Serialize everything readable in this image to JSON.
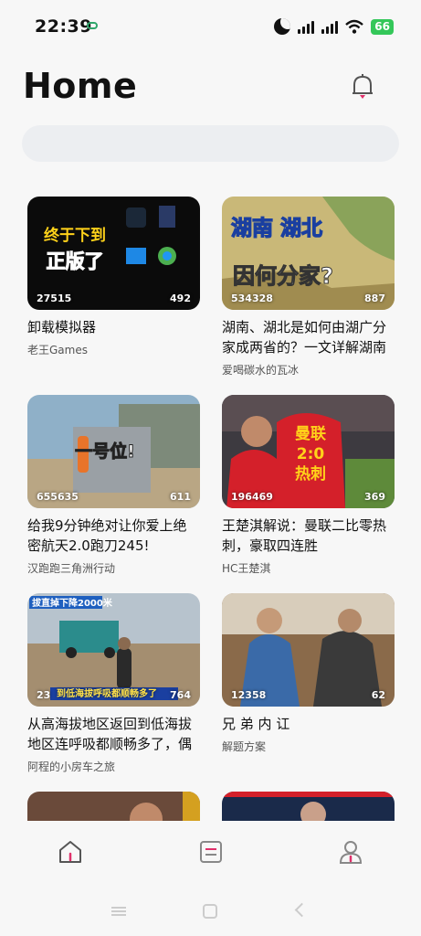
{
  "status_bar": {
    "time": "22:39",
    "battery": "66"
  },
  "header": {
    "title": "Home"
  },
  "videos": [
    {
      "thumb_text": "终于下到正版了",
      "views": "27515",
      "comments": "492",
      "title": "卸载模拟器",
      "author": "老王Games"
    },
    {
      "thumb_text": "湖南 湖北 因何分家?",
      "views": "534328",
      "comments": "887",
      "title": "湖南、湖北是如何由湖广分家成两省的？一文详解湖南湖北",
      "author": "爱喝碳水的瓦冰"
    },
    {
      "thumb_text": "一号位!",
      "views": "655635",
      "comments": "611",
      "title": "给我9分钟绝对让你爱上绝密航天2.0跑刀245!",
      "author": "汉跑跑三角洲行动"
    },
    {
      "thumb_text": "曼联 2:0 热刺",
      "views": "196469",
      "comments": "369",
      "title": "王楚淇解说：曼联二比零热刺，豪取四连胜",
      "author": "HC王楚淇"
    },
    {
      "thumb_text": "拔直掉下降2000米",
      "thumb_caption": "到低海拔呼吸都顺畅多了",
      "views": "23",
      "comments": "764",
      "title": "从高海拔地区返回到低海拔地区连呼吸都顺畅多了，偶遇拍",
      "author": "阿程的小房车之旅"
    },
    {
      "thumb_text": "",
      "views": "12358",
      "comments": "62",
      "title": "兄 弟 内 讧",
      "author": "解题方案"
    },
    {
      "thumb_text": "",
      "views": "",
      "comments": "",
      "title": "",
      "author": ""
    },
    {
      "thumb_text": "",
      "views": "",
      "comments": "",
      "title": "",
      "author": ""
    }
  ],
  "nav": {
    "items": [
      "home-icon",
      "list-icon",
      "profile-icon"
    ],
    "accent": "#e0306a"
  }
}
